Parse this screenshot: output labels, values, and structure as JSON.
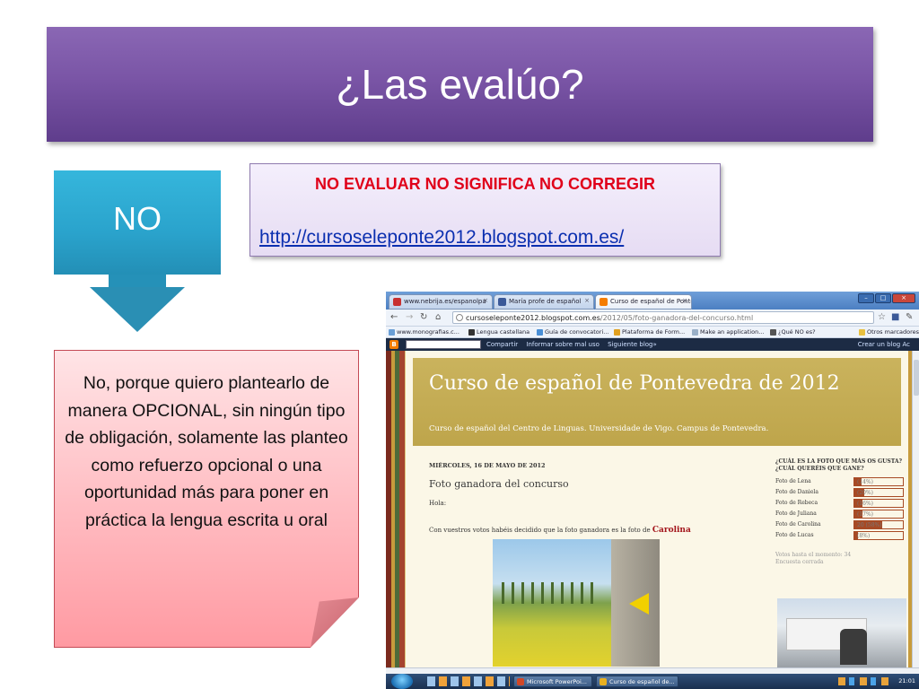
{
  "slide": {
    "title": "¿Las evalúo?",
    "no_label": "NO",
    "note_title": "NO EVALUAR NO SIGNIFICA NO CORREGIR",
    "note_link": "http://cursoseleponte2012.blogspot.com.es/",
    "pink_text": "No, porque quiero plantearlo de manera OPCIONAL, sin ningún tipo de obligación, solamente las planteo como refuerzo opcional o una oportunidad más para poner en práctica la lengua escrita u oral"
  },
  "browser": {
    "tabs": [
      {
        "label": "www.nebrija.es/espanolpa",
        "color": "#c83030"
      },
      {
        "label": "María profe de español",
        "color": "#3b5998"
      },
      {
        "label": "Curso de español de Ponte",
        "color": "#f57d00"
      }
    ],
    "address_host": "cursoseleponte2012.blogspot.com.es",
    "address_path": "/2012/05/foto-ganadora-del-concurso.html",
    "bookmarks": [
      {
        "label": "www.monografias.c...",
        "color": "#6a9fd6"
      },
      {
        "label": "Lengua castellana",
        "color": "#333333"
      },
      {
        "label": "Guía de convocatori...",
        "color": "#4a8fd6"
      },
      {
        "label": "Plataforma de Form...",
        "color": "#e0a020"
      },
      {
        "label": "Make an application...",
        "color": "#9ab0c8"
      },
      {
        "label": "¿Qué NO es?",
        "color": "#555555"
      }
    ],
    "bookmarks_other": "Otros marcadores",
    "blogger_links": [
      "Compartir",
      "Informar sobre mal uso",
      "Siguiente blog»"
    ],
    "blogger_right": "Crear un blog",
    "blogger_right_trunc": "Ac",
    "blog": {
      "title": "Curso de español de Pontevedra de 2012",
      "description": "Curso de español del Centro de Linguas. Universidade de Vigo. Campus de Pontevedra.",
      "post_date": "MIÉRCOLES, 16 DE MAYO DE 2012",
      "post_title": "Foto ganadora del concurso",
      "post_greeting": "Hola:",
      "post_line": "Con vuestros votos habéis decidido que la foto ganadora es la foto de",
      "post_winner": "Carolina",
      "poll_title": "¿CUÁL ES LA FOTO QUE MÁS OS GUSTA? ¿CUÁL QUERÉIS QUE GANE?",
      "poll": [
        {
          "label": "Foto de Lena",
          "pct_text": "(14%)",
          "pct": 0.14
        },
        {
          "label": "Foto de Daniela",
          "pct_text": "(20%)",
          "pct": 0.2
        },
        {
          "label": "Foto de Rebeca",
          "pct_text": "(16%)",
          "pct": 0.16
        },
        {
          "label": "Foto de Juliana",
          "pct_text": "(17%)",
          "pct": 0.17
        },
        {
          "label": "Foto de Carolina",
          "pct_text": "20 (58%)",
          "pct": 0.58
        },
        {
          "label": "Foto de Lucas",
          "pct_text": "(8%)",
          "pct": 0.08
        }
      ],
      "poll_votes": "Votos hasta el momento: 34",
      "poll_status": "Encuesta cerrada"
    },
    "taskbar": {
      "tasks": [
        {
          "label": "Microsoft PowerPoi...",
          "color": "#d24726"
        },
        {
          "label": "Curso de español de...",
          "color": "#e8b020"
        }
      ],
      "clock": "21:01"
    }
  }
}
